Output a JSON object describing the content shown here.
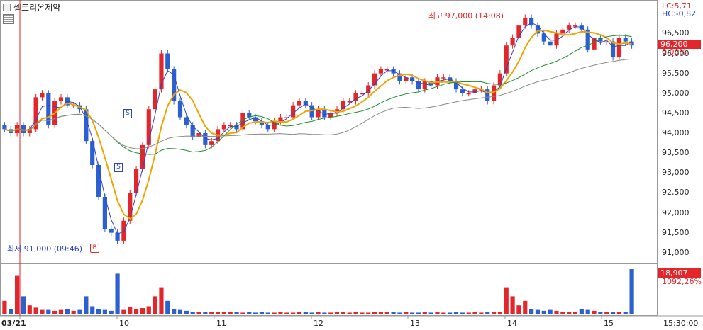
{
  "window": {
    "title": "셀트리온제약"
  },
  "indicators": {
    "lc": "LC:5,71",
    "hc": "HC:-0,82"
  },
  "current": {
    "price": "96,200",
    "change": "0,00%"
  },
  "volume": {
    "value": "18,907",
    "ratio": "1092,26%"
  },
  "annotations": {
    "high": "최고 97,000 (14:08)",
    "low": "최저 91,000 (09:46)",
    "buy_marker": "B",
    "sell_marker": "S"
  },
  "chart_data": {
    "type": "candlestick",
    "x_ticks": [
      "03/21",
      "10",
      "11",
      "12",
      "13",
      "14",
      "15",
      "15:30:00"
    ],
    "y_ticks": [
      "96,500",
      "96,000",
      "95,500",
      "95,000",
      "94,500",
      "94,000",
      "93,500",
      "93,000",
      "92,500",
      "92,000",
      "91,500",
      "91,000"
    ],
    "ylim": [
      90800,
      97200
    ],
    "high": {
      "value": 97000,
      "time": "14:08"
    },
    "low": {
      "value": 91000,
      "time": "09:46"
    },
    "last": 96200,
    "close_series_approx": [
      94100,
      94000,
      94200,
      94000,
      94100,
      94900,
      95000,
      94200,
      94800,
      94900,
      94700,
      94700,
      94600,
      93800,
      93200,
      92400,
      91600,
      91500,
      91300,
      91800,
      92500,
      93100,
      93700,
      94600,
      95100,
      96000,
      95600,
      94800,
      94400,
      94200,
      93900,
      94000,
      93700,
      93800,
      94100,
      94200,
      94200,
      94100,
      94500,
      94400,
      94300,
      94200,
      94100,
      94300,
      94400,
      94400,
      94700,
      94800,
      94700,
      94400,
      94600,
      94400,
      94500,
      94600,
      94800,
      94800,
      95000,
      95000,
      95200,
      95500,
      95600,
      95600,
      95500,
      95300,
      95400,
      95300,
      95100,
      95300,
      95200,
      95400,
      95400,
      95300,
      95100,
      95000,
      95000,
      95100,
      95100,
      94800,
      95200,
      95500,
      96200,
      96400,
      96700,
      96900,
      96700,
      96500,
      96300,
      96200,
      96500,
      96600,
      96700,
      96700,
      96600,
      96100,
      96400,
      96300,
      96300,
      95900,
      96400,
      96300,
      96200
    ],
    "ma_series": [
      {
        "color": "#2c47c8"
      },
      {
        "color": "#f0a400"
      },
      {
        "color": "#1f8f2e"
      },
      {
        "color": "#8a8a8a"
      }
    ],
    "volume_relative": [
      0.3,
      0.12,
      0.85,
      0.4,
      0.2,
      0.15,
      0.1,
      0.1,
      0.08,
      0.1,
      0.12,
      0.08,
      0.1,
      0.4,
      0.18,
      0.12,
      0.1,
      0.08,
      0.9,
      0.1,
      0.16,
      0.12,
      0.14,
      0.18,
      0.4,
      0.6,
      0.3,
      0.12,
      0.1,
      0.08,
      0.06,
      0.06,
      0.05,
      0.06,
      0.05,
      0.06,
      0.06,
      0.05,
      0.04,
      0.05,
      0.04,
      0.05,
      0.04,
      0.04,
      0.05,
      0.04,
      0.04,
      0.05,
      0.05,
      0.04,
      0.05,
      0.04,
      0.04,
      0.05,
      0.05,
      0.04,
      0.05,
      0.04,
      0.04,
      0.05,
      0.05,
      0.06,
      0.05,
      0.04,
      0.05,
      0.04,
      0.04,
      0.05,
      0.04,
      0.05,
      0.04,
      0.04,
      0.05,
      0.04,
      0.04,
      0.05,
      0.04,
      0.05,
      0.06,
      0.06,
      0.6,
      0.4,
      0.2,
      0.3,
      0.12,
      0.1,
      0.08,
      0.1,
      0.08,
      0.06,
      0.06,
      0.05,
      0.12,
      0.1,
      0.08,
      0.06,
      0.06,
      0.05,
      0.06,
      0.05,
      1.0
    ]
  }
}
